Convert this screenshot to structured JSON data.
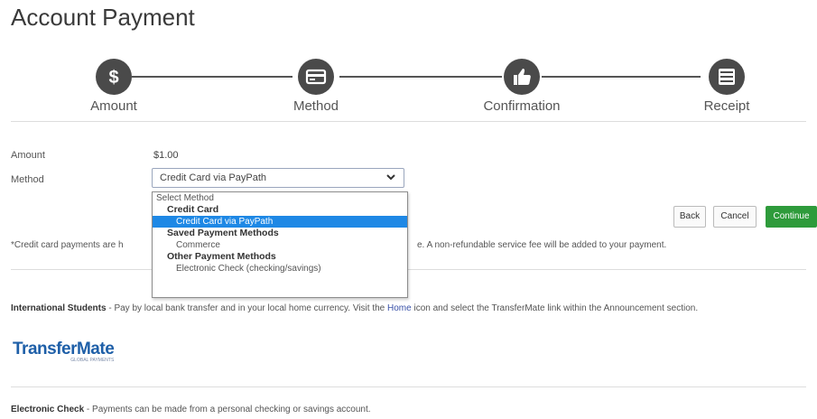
{
  "page": {
    "title": "Account Payment"
  },
  "stepper": {
    "steps": [
      {
        "label": "Amount",
        "icon": "dollar-icon"
      },
      {
        "label": "Method",
        "icon": "credit-card-icon"
      },
      {
        "label": "Confirmation",
        "icon": "thumbs-up-icon"
      },
      {
        "label": "Receipt",
        "icon": "list-icon"
      }
    ]
  },
  "form": {
    "amount_label": "Amount",
    "amount_value": "$1.00",
    "method_label": "Method",
    "method_selected": "Credit Card via PayPath"
  },
  "dropdown": {
    "items": [
      {
        "text": "Select Method",
        "kind": "option"
      },
      {
        "text": "Credit Card",
        "kind": "group"
      },
      {
        "text": "Credit Card via PayPath",
        "kind": "option-selected"
      },
      {
        "text": "Saved Payment Methods",
        "kind": "group"
      },
      {
        "text": "Commerce",
        "kind": "option"
      },
      {
        "text": "Other Payment Methods",
        "kind": "group"
      },
      {
        "text": "Electronic Check (checking/savings)",
        "kind": "option"
      }
    ]
  },
  "buttons": {
    "back": "Back",
    "cancel": "Cancel",
    "continue": "Continue"
  },
  "notice": {
    "start": "*Credit card payments are h",
    "end": "e. A non-refundable service fee will be added to your payment."
  },
  "international": {
    "heading": "International Students",
    "text_1": " - Pay by local bank transfer and in your local home currency. Visit the ",
    "link": "Home",
    "text_2": " icon and select the TransferMate link within the Announcement section."
  },
  "transfermate": {
    "logo_text": "TransferMate",
    "tagline": "GLOBAL PAYMENTS"
  },
  "echeck": {
    "heading": "Electronic Check",
    "text": " - Payments can be made from a personal checking or savings account."
  },
  "colors": {
    "primary_button": "#2e9b3b",
    "selected_option": "#1e88e5",
    "step_icon": "#4a4a4a",
    "logo": "#1e5fa8"
  }
}
